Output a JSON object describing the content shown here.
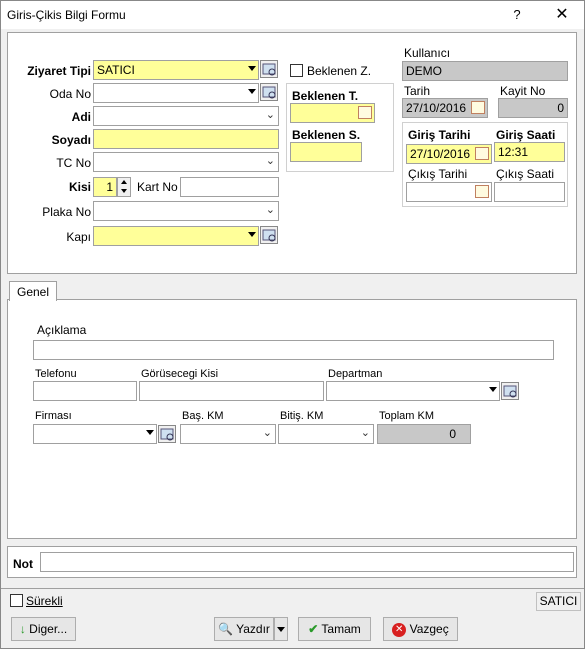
{
  "window": {
    "title": "Giris-Çikis Bilgi Formu",
    "help": "?",
    "close": "✕"
  },
  "form": {
    "ziyaret_tipi": {
      "label": "Ziyaret Tipi",
      "value": "SATICI"
    },
    "oda_no": {
      "label": "Oda No",
      "value": ""
    },
    "adi": {
      "label": "Adi",
      "value": ""
    },
    "soyadi": {
      "label": "Soyadı",
      "value": ""
    },
    "tc_no": {
      "label": "TC No",
      "value": ""
    },
    "kisi": {
      "label": "Kisi",
      "value": "1"
    },
    "kart_no": {
      "label": "Kart No",
      "value": ""
    },
    "plaka_no": {
      "label": "Plaka No",
      "value": ""
    },
    "kapi": {
      "label": "Kapı",
      "value": ""
    },
    "beklenen_z": {
      "label": "Beklenen Z."
    },
    "beklenen_t": {
      "label": "Beklenen T.",
      "value": ""
    },
    "beklenen_s": {
      "label": "Beklenen S.",
      "value": ""
    },
    "kullanici": {
      "label": "Kullanıcı",
      "value": "DEMO"
    },
    "tarih": {
      "label": "Tarih",
      "value": "27/10/2016"
    },
    "kayit_no": {
      "label": "Kayit No",
      "value": "0"
    },
    "giris_tarihi": {
      "label": "Giriş Tarihi",
      "value": "27/10/2016"
    },
    "giris_saati": {
      "label": "Giriş Saati",
      "value": "12:31"
    },
    "cikis_tarihi": {
      "label": "Çıkış Tarihi",
      "value": ""
    },
    "cikis_saati": {
      "label": "Çıkış Saati",
      "value": ""
    }
  },
  "tabs": [
    {
      "label": "Genel"
    }
  ],
  "genel": {
    "aciklama": {
      "label": "Açıklama",
      "value": ""
    },
    "telefonu": {
      "label": "Telefonu",
      "value": ""
    },
    "gorusecegi": {
      "label": "Görüsecegi Kisi",
      "value": ""
    },
    "departman": {
      "label": "Departman",
      "value": ""
    },
    "firmasi": {
      "label": "Firması",
      "value": ""
    },
    "bas_km": {
      "label": "Baş. KM",
      "value": ""
    },
    "bitis_km": {
      "label": "Bitiş. KM",
      "value": ""
    },
    "toplam_km": {
      "label": "Toplam KM",
      "value": "0"
    }
  },
  "not": {
    "label": "Not",
    "value": ""
  },
  "status": {
    "surekli_label": "Sürekli",
    "right_text": "SATICI"
  },
  "buttons": {
    "diger": "Diger...",
    "yazdir": "Yazdır",
    "tamam": "Tamam",
    "vazgec": "Vazgeç"
  },
  "colors": {
    "field_yellow": "#ffff99",
    "readonly_gray": "#c8c8c8",
    "window_bg": "#f0f0f0"
  }
}
